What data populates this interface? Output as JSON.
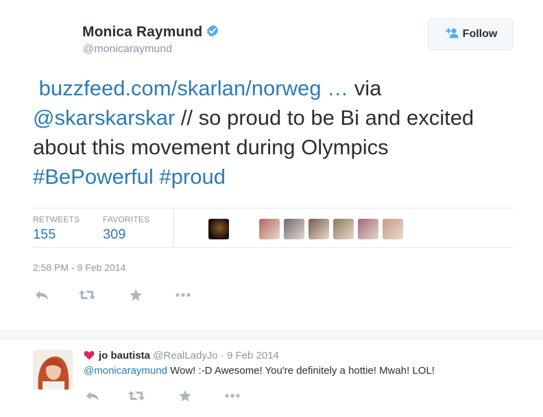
{
  "author": {
    "name": "Monica Raymund",
    "handle": "@monicaraymund",
    "verified": true
  },
  "follow_button": {
    "label": "Follow"
  },
  "tweet": {
    "link": "buzzfeed.com/skarlan/norweg",
    "ellipsis": " … ",
    "via": "via",
    "mention": "@skarskarskar",
    "text_part": " // so proud to be Bi and excited about this movement during Olympics ",
    "hashtag1": "#BePowerful",
    "hashtag2": "#proud"
  },
  "stats": {
    "retweets_label": "RETWEETS",
    "retweets_value": "155",
    "favorites_label": "FAVORITES",
    "favorites_value": "309"
  },
  "favoriter_avatar_colors": [
    "#2a1a0e",
    "#b06a5c",
    "#6d6a70",
    "#7a5a4e",
    "#8a7a5a",
    "#a06878",
    "#c99a86"
  ],
  "timestamp": "2:58 PM - 9 Feb 2014",
  "actions": [
    "reply-icon",
    "retweet-icon",
    "favorite-icon",
    "more-icon"
  ],
  "reply": {
    "name": "jo bautista",
    "handle": "@RealLadyJo",
    "separator": "·",
    "time": "9 Feb 2014",
    "mention": "@monicaraymund",
    "text": " Wow!  :-D  Awesome!  You're definitely a hottie!  Mwah! LOL!",
    "heart_color": "#e0245e"
  },
  "colors": {
    "link": "#2b7bb9",
    "muted": "#8899a6",
    "text": "#292f33",
    "verified": "#55acee",
    "action_icon": "#aab8c2"
  }
}
